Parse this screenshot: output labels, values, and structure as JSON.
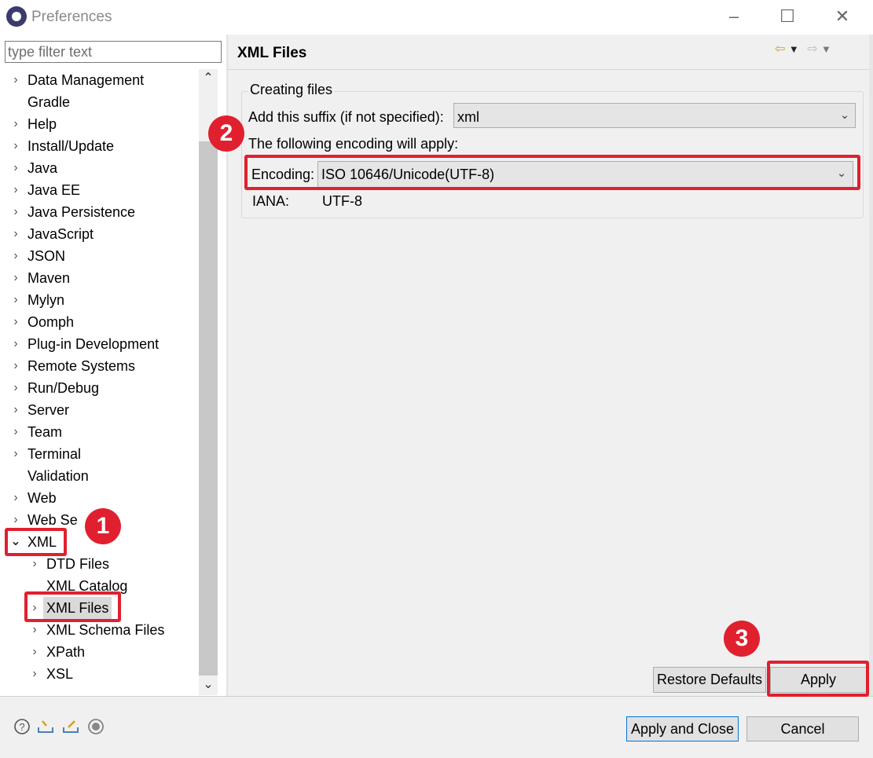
{
  "window": {
    "title": "Preferences",
    "minimize": "–",
    "maximize": "☐",
    "close": "✕"
  },
  "filter": {
    "placeholder": "type filter text"
  },
  "tree": {
    "items": [
      {
        "label": "Data Management",
        "expander": "›"
      },
      {
        "label": "Gradle",
        "expander": ""
      },
      {
        "label": "Help",
        "expander": "›"
      },
      {
        "label": "Install/Update",
        "expander": "›"
      },
      {
        "label": "Java",
        "expander": "›"
      },
      {
        "label": "Java EE",
        "expander": "›"
      },
      {
        "label": "Java Persistence",
        "expander": "›"
      },
      {
        "label": "JavaScript",
        "expander": "›"
      },
      {
        "label": "JSON",
        "expander": "›"
      },
      {
        "label": "Maven",
        "expander": "›"
      },
      {
        "label": "Mylyn",
        "expander": "›"
      },
      {
        "label": "Oomph",
        "expander": "›"
      },
      {
        "label": "Plug-in Development",
        "expander": "›"
      },
      {
        "label": "Remote Systems",
        "expander": "›"
      },
      {
        "label": "Run/Debug",
        "expander": "›"
      },
      {
        "label": "Server",
        "expander": "›"
      },
      {
        "label": "Team",
        "expander": "›"
      },
      {
        "label": "Terminal",
        "expander": "›"
      },
      {
        "label": "Validation",
        "expander": ""
      },
      {
        "label": "Web",
        "expander": "›"
      },
      {
        "label": "Web Se",
        "expander": "›"
      },
      {
        "label": "XML",
        "expander": "⌄"
      },
      {
        "label": "DTD Files",
        "expander": "›"
      },
      {
        "label": "XML Catalog",
        "expander": ""
      },
      {
        "label": "XML Files",
        "expander": "›"
      },
      {
        "label": "XML Schema Files",
        "expander": "›"
      },
      {
        "label": "XPath",
        "expander": "›"
      },
      {
        "label": "XSL",
        "expander": "›"
      }
    ],
    "selected": "XML Files"
  },
  "page": {
    "title": "XML Files",
    "group_label": "Creating files",
    "suffix_label": "Add this suffix (if not specified):",
    "suffix_value": "xml",
    "encoding_note": "The following encoding will apply:",
    "encoding_label": "Encoding:",
    "encoding_value": "ISO 10646/Unicode(UTF-8)",
    "iana_label": "IANA:",
    "iana_value": "UTF-8",
    "restore_label": "Restore Defaults",
    "apply_label": "Apply"
  },
  "footer": {
    "apply_close_label": "Apply and Close",
    "cancel_label": "Cancel",
    "icons": [
      "help-icon",
      "import-icon",
      "export-icon",
      "oomph-icon"
    ]
  },
  "annotations": {
    "step1": "1",
    "step2": "2",
    "step3": "3",
    "color": "#e0202e"
  }
}
